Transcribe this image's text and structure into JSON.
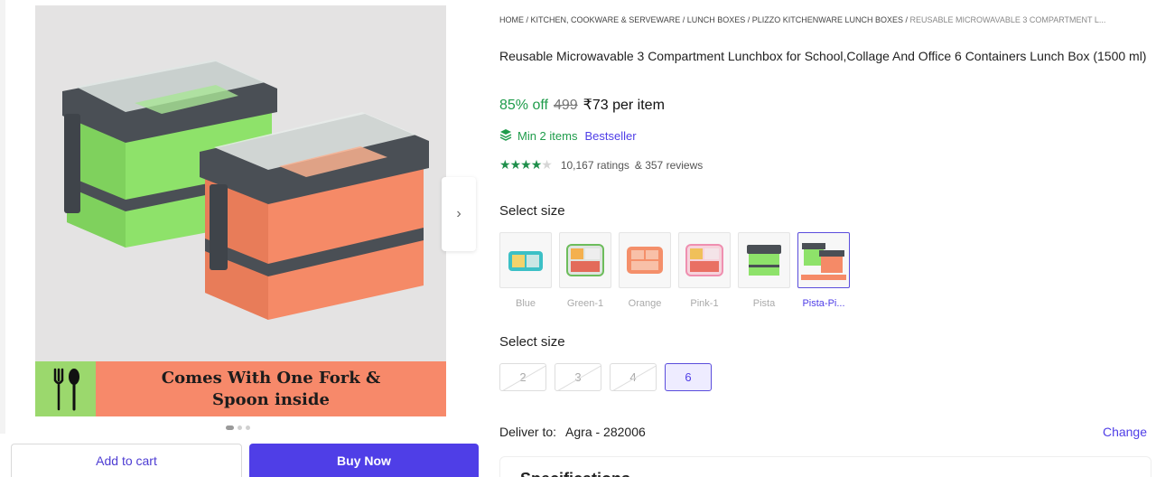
{
  "gallery": {
    "banner_line1": "Comes With One Fork &",
    "banner_line2": "Spoon inside",
    "next_arrow": "›",
    "dots_count": 3,
    "active_dot": 1
  },
  "actions": {
    "add_to_cart": "Add to cart",
    "buy_now": "Buy Now"
  },
  "breadcrumb": {
    "items": [
      "HOME",
      "KITCHEN, COOKWARE & SERVEWARE",
      "LUNCH BOXES",
      "PLIZZO KITCHENWARE LUNCH BOXES"
    ],
    "current": "REUSABLE MICROWAVABLE 3 COMPARTMENT L...",
    "separator": " / "
  },
  "product": {
    "title": "Reusable Microwavable 3 Compartment Lunchbox for School,Collage And Office 6 Containers Lunch Box (1500 ml)",
    "discount": "85% off",
    "mrp": "499",
    "price": "₹73 per item",
    "min_items": "Min 2 items",
    "badge": "Bestseller",
    "rating_value": 4,
    "rating_max": 5,
    "ratings": "10,167 ratings",
    "reviews": "& 357 reviews"
  },
  "variants": {
    "color_label": "Select size",
    "colors": [
      {
        "name": "Blue",
        "selected": false
      },
      {
        "name": "Green-1",
        "selected": false
      },
      {
        "name": "Orange",
        "selected": false
      },
      {
        "name": "Pink-1",
        "selected": false
      },
      {
        "name": "Pista",
        "selected": false
      },
      {
        "name": "Pista-Pi...",
        "selected": true
      }
    ],
    "size_label": "Select size",
    "sizes": [
      {
        "value": "2",
        "state": "disabled"
      },
      {
        "value": "3",
        "state": "disabled"
      },
      {
        "value": "4",
        "state": "disabled"
      },
      {
        "value": "6",
        "state": "selected"
      }
    ]
  },
  "delivery": {
    "label": "Deliver to:",
    "location": "Agra - 282006",
    "change": "Change"
  },
  "next_section": {
    "title": "Specifications"
  },
  "colors": {
    "accent": "#4f3ee7",
    "discount_green": "#1f9c4b",
    "banner_green": "#9bd86d",
    "banner_salmon": "#f7896a",
    "box_green": "#8ee26a",
    "box_orange": "#f58a67",
    "lid_gray": "#4a4f55"
  }
}
